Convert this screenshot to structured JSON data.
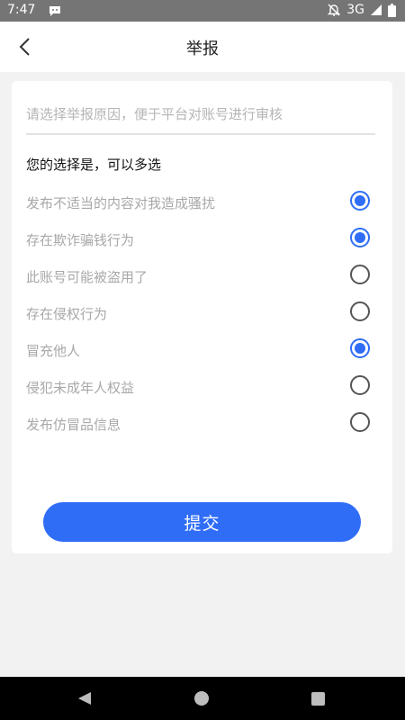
{
  "status_bar": {
    "time": "7:47",
    "network": "3G"
  },
  "header": {
    "title": "举报"
  },
  "form": {
    "placeholder": "请选择举报原因，便于平台对账号进行审核",
    "section_title": "您的选择是，可以多选",
    "options": [
      {
        "label": "发布不适当的内容对我造成骚扰",
        "checked": true
      },
      {
        "label": "存在欺诈骗钱行为",
        "checked": true
      },
      {
        "label": "此账号可能被盗用了",
        "checked": false
      },
      {
        "label": "存在侵权行为",
        "checked": false
      },
      {
        "label": "冒充他人",
        "checked": true
      },
      {
        "label": "侵犯未成年人权益",
        "checked": false
      },
      {
        "label": "发布仿冒品信息",
        "checked": false
      }
    ],
    "submit_label": "提交"
  },
  "colors": {
    "accent": "#2f6df6",
    "status_bar": "#757575",
    "nav_bar": "#000000"
  },
  "icons": {
    "back": "chevron-left-icon",
    "notification": "chat-bubble-icon",
    "mute": "bell-off-icon",
    "signal": "signal-icon",
    "battery": "battery-icon"
  }
}
